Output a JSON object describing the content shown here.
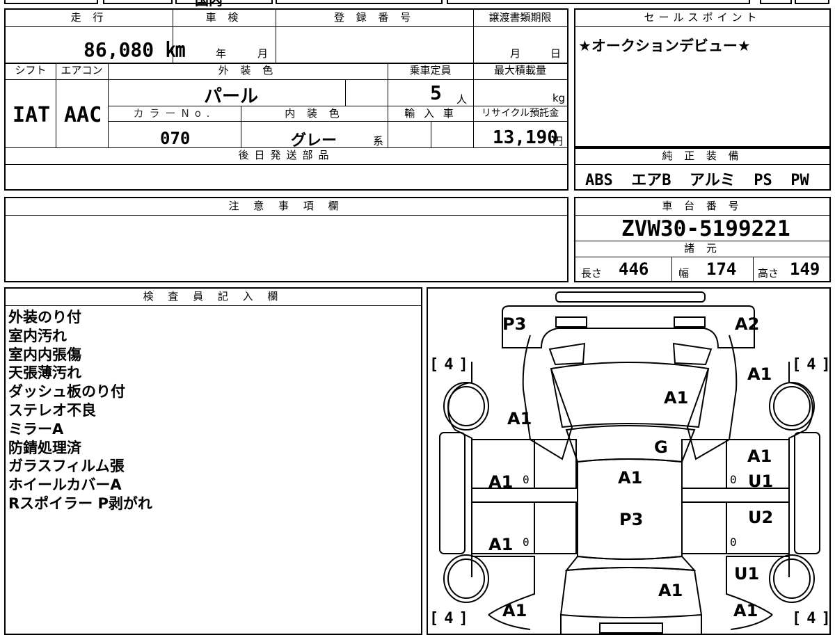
{
  "top_strip_text": "国内",
  "mileage": {
    "label": "走 行",
    "value": "86,080 ㎞"
  },
  "inspection": {
    "label": "車 検",
    "year_unit": "年",
    "month_unit": "月"
  },
  "registration": {
    "label": "登 録 番 号",
    "value": ""
  },
  "transfer_deadline": {
    "label": "譲渡書類期限",
    "month_unit": "月",
    "day_unit": "日"
  },
  "sales_point": {
    "label": "セールスポイント",
    "text": "★オークションデビュー★"
  },
  "shift": {
    "label": "シフト",
    "value": "IAT"
  },
  "aircon": {
    "label": "エアコン",
    "value": "AAC"
  },
  "exterior_color": {
    "label": "外 装 色",
    "value": "パール"
  },
  "capacity": {
    "label": "乗車定員",
    "value": "5",
    "unit": "人"
  },
  "max_load": {
    "label": "最大積載量",
    "unit": "kg"
  },
  "color_no": {
    "label": "カラーNo.",
    "value": "070"
  },
  "interior_color": {
    "label": "内 装 色",
    "value": "グレー",
    "suffix": "系"
  },
  "import_car": {
    "label": "輸 入 車"
  },
  "recycle_fee": {
    "label": "リサイクル預託金",
    "value": "13,190",
    "unit": "円"
  },
  "later_parts": {
    "label": "後日発送部品",
    "value": ""
  },
  "genuine_equipment": {
    "label": "純 正 装 備",
    "items": "ABS  エアB  アルミ  PS  PW"
  },
  "caution": {
    "label": "注 意 事 項 欄",
    "value": ""
  },
  "chassis": {
    "label": "車 台 番 号",
    "value": "ZVW30-5199221"
  },
  "specs": {
    "label": "諸 元",
    "length_label": "長さ",
    "length": "446",
    "width_label": "幅",
    "width": "174",
    "height_label": "高さ",
    "height": "149"
  },
  "inspector": {
    "label": "検 査 員 記 入 欄",
    "notes": [
      "外装のり付",
      "室内汚れ",
      "室内内張傷",
      "天張薄汚れ",
      "ダッシュ板のり付",
      "ステレオ不良",
      "ミラーA",
      "防錆処理済",
      "ガラスフィルム張",
      "ホイールカバーA",
      "Rスポイラー P剥がれ"
    ]
  },
  "diagram": {
    "tread": "4",
    "marks": {
      "front_left_bumper": "P3",
      "front_right_bumper": "A2",
      "hood": "A1",
      "left_front_fender": "A1",
      "right_front_fender": "A1",
      "windshield": "G",
      "right_front_door": "A1",
      "right_rear_door": "U1",
      "left_front_door": "A1",
      "left_rear_door": "A1",
      "roof_front": "A1",
      "roof_rear": "P3",
      "right_quarter": "U2",
      "right_rear_fender": "U1",
      "trunk": "A1",
      "left_rear_bumper": "A1",
      "right_rear_bumper": "A1",
      "door_zero": "0"
    }
  }
}
